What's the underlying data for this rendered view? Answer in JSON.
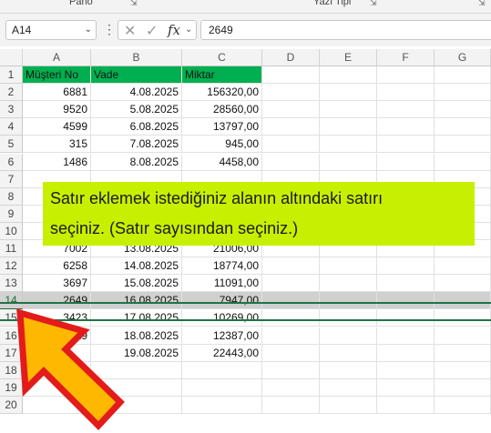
{
  "ribbon": {
    "groups": [
      {
        "label": "Pano"
      },
      {
        "label": "Yazı Tipi"
      }
    ]
  },
  "formula_bar": {
    "name_box": "A14",
    "cancel_icon": "cancel-icon",
    "enter_icon": "check-icon",
    "fx_label": "fx",
    "value": "2649"
  },
  "columns": [
    "A",
    "B",
    "C",
    "D",
    "E",
    "F",
    "G"
  ],
  "rows": [
    {
      "num": "1",
      "a": "Müşteri No",
      "b": "Vade",
      "c": "Miktar"
    },
    {
      "num": "2",
      "a": "6881",
      "b": "4.08.2025",
      "c": "156320,00"
    },
    {
      "num": "3",
      "a": "9520",
      "b": "5.08.2025",
      "c": "28560,00"
    },
    {
      "num": "4",
      "a": "4599",
      "b": "6.08.2025",
      "c": "13797,00"
    },
    {
      "num": "5",
      "a": "315",
      "b": "7.08.2025",
      "c": "945,00"
    },
    {
      "num": "6",
      "a": "1486",
      "b": "8.08.2025",
      "c": "4458,00"
    },
    {
      "num": "7",
      "a": "",
      "b": "",
      "c": ""
    },
    {
      "num": "8",
      "a": "",
      "b": "",
      "c": ""
    },
    {
      "num": "9",
      "a": "",
      "b": "",
      "c": ""
    },
    {
      "num": "10",
      "a": "",
      "b": "",
      "c": ""
    },
    {
      "num": "11",
      "a": "7002",
      "b": "13.08.2025",
      "c": "21006,00"
    },
    {
      "num": "12",
      "a": "6258",
      "b": "14.08.2025",
      "c": "18774,00"
    },
    {
      "num": "13",
      "a": "3697",
      "b": "15.08.2025",
      "c": "11091,00"
    },
    {
      "num": "14",
      "a": "2649",
      "b": "16.08.2025",
      "c": "7947,00"
    },
    {
      "num": "15",
      "a": "3423",
      "b": "17.08.2025",
      "c": "10269,00"
    },
    {
      "num": "16",
      "a": "4129",
      "b": "18.08.2025",
      "c": "12387,00"
    },
    {
      "num": "17",
      "a": "",
      "b": "19.08.2025",
      "c": "22443,00"
    },
    {
      "num": "18",
      "a": "",
      "b": "",
      "c": ""
    },
    {
      "num": "19",
      "a": "",
      "b": "",
      "c": ""
    },
    {
      "num": "20",
      "a": "",
      "b": "",
      "c": ""
    }
  ],
  "callout": {
    "line1": "Satır eklemek istediğiniz alanın altındaki satırı",
    "line2": "seçiniz. (Satır sayısından seçiniz.)"
  },
  "colors": {
    "header_fill": "#00b050",
    "callout_fill": "#c6f000",
    "arrow_fill": "#ffb800",
    "arrow_stroke": "#e31b1b",
    "selection": "#217346"
  }
}
